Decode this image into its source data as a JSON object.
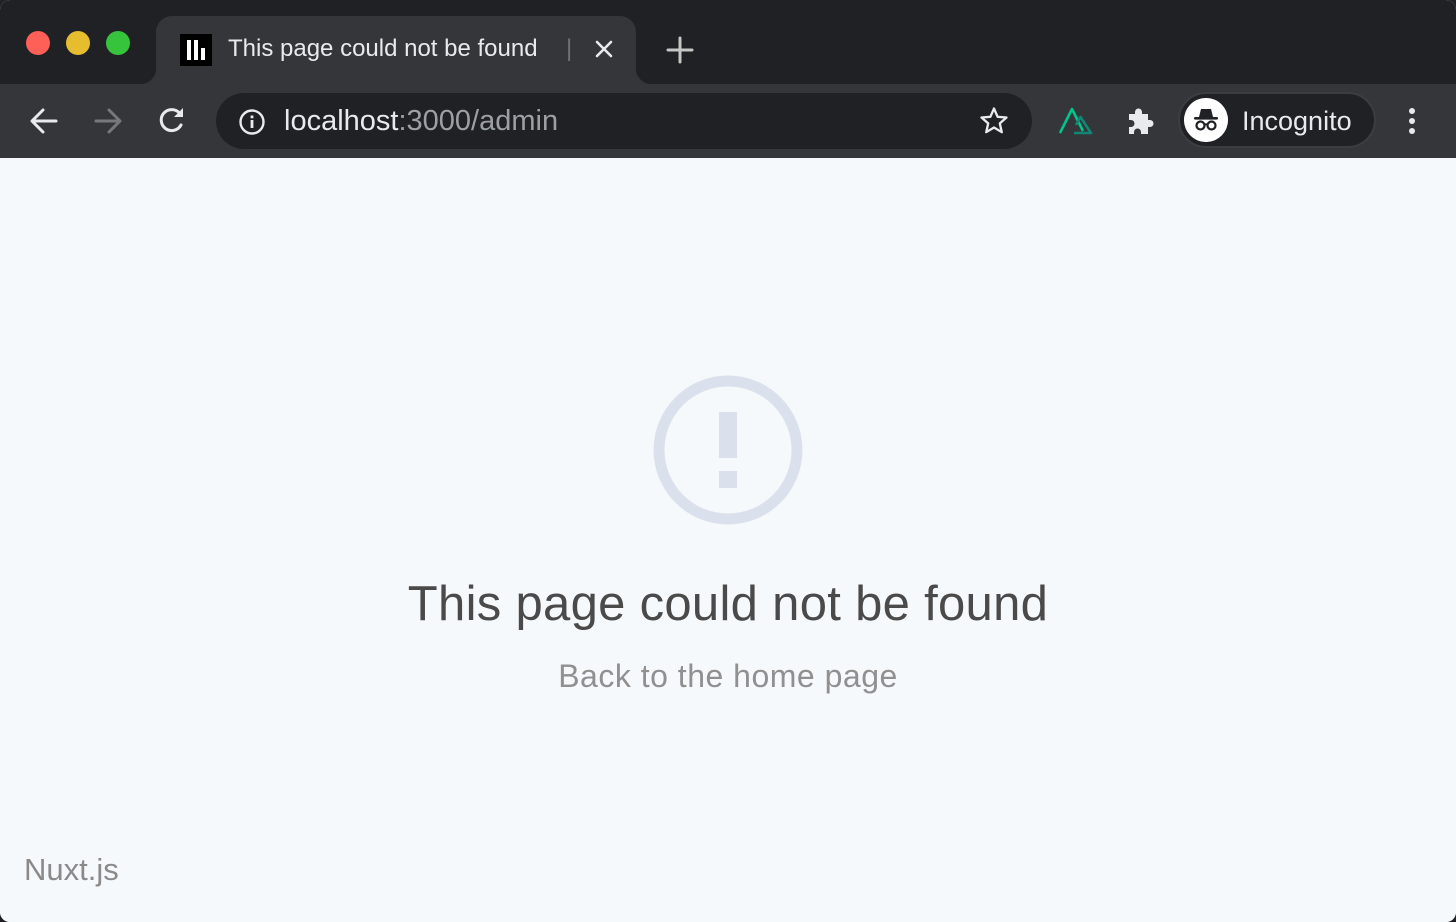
{
  "browser": {
    "tab": {
      "title": "This page could not be found",
      "separator": "|",
      "favicon": "nuxt-favicon"
    },
    "omnibox": {
      "host": "localhost",
      "path": ":3000/admin"
    },
    "profile": {
      "label": "Incognito"
    },
    "colors": {
      "traffic_red": "#fe5f57",
      "traffic_yellow": "#e6bd2f",
      "traffic_green": "#37c43d",
      "nuxt_green": "#00c58e"
    }
  },
  "page": {
    "heading": "This page could not be found",
    "home_link": "Back to the home page",
    "brand": "Nuxt.js",
    "icon": "alert-circle-icon"
  }
}
